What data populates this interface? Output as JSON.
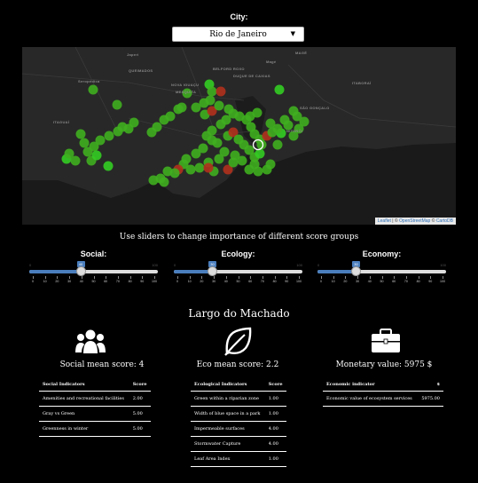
{
  "city": {
    "label": "City:",
    "selected": "Rio de Janeiro"
  },
  "map": {
    "place_labels": [
      "QUEIMADOS",
      "NOVA IGUAÇU",
      "MESQUITA",
      "BELFORD ROXO",
      "DUQUE DE CAXIAS",
      "MAGÉ",
      "ITABORAÍ",
      "SÃO GONÇALO",
      "NITERÓI",
      "ITAGUAÍ",
      "Seropédica",
      "Japeri",
      "Magé"
    ],
    "attribution": {
      "leaflet": "Leaflet",
      "sep": " | © ",
      "osm": "OpenStreetMap",
      "mid": " © ",
      "carto": "CartoDB"
    }
  },
  "instructions": "Use sliders to change importance of different score groups",
  "sliders": [
    {
      "title": "Social:",
      "value": "40",
      "min": "0",
      "max": "100"
    },
    {
      "title": "Ecology:",
      "value": "30",
      "min": "0",
      "max": "100"
    },
    {
      "title": "Economy:",
      "value": "30",
      "min": "0",
      "max": "100"
    }
  ],
  "slider_ticks": [
    "0",
    "10",
    "20",
    "30",
    "40",
    "50",
    "60",
    "70",
    "80",
    "90",
    "100"
  ],
  "place_name": "Largo do Machado",
  "social": {
    "icon": "people-icon",
    "title": "Social mean score: 4",
    "headers": [
      "Social Indicators",
      "Score"
    ],
    "rows": [
      [
        "Amenities and recreational facilities",
        "2.00"
      ],
      [
        "Gray vs Green",
        "5.00"
      ],
      [
        "Greenness in winter",
        "5.00"
      ]
    ]
  },
  "eco": {
    "icon": "leaf-icon",
    "title": "Eco mean score: 2.2",
    "headers": [
      "Ecological Indicators",
      "Score"
    ],
    "rows": [
      [
        "Green within a riparian zone",
        "1.00"
      ],
      [
        "Width of blue space in a park",
        "1.00"
      ],
      [
        "Impermeable surfaces",
        "4.00"
      ],
      [
        "Stormwater Capture",
        "4.00"
      ],
      [
        "Leaf Area Index",
        "1.00"
      ]
    ]
  },
  "economy": {
    "icon": "briefcase-icon",
    "title": "Monetary value: 5975 $",
    "headers": [
      "Economic indicator",
      "$"
    ],
    "rows": [
      [
        "Economic value of ecosystem services",
        "5975.00"
      ]
    ]
  },
  "colors": {
    "good": "#3fae1f",
    "bright": "#33cc22",
    "bad": "#b0301c",
    "slider": "#4a7ebd"
  }
}
